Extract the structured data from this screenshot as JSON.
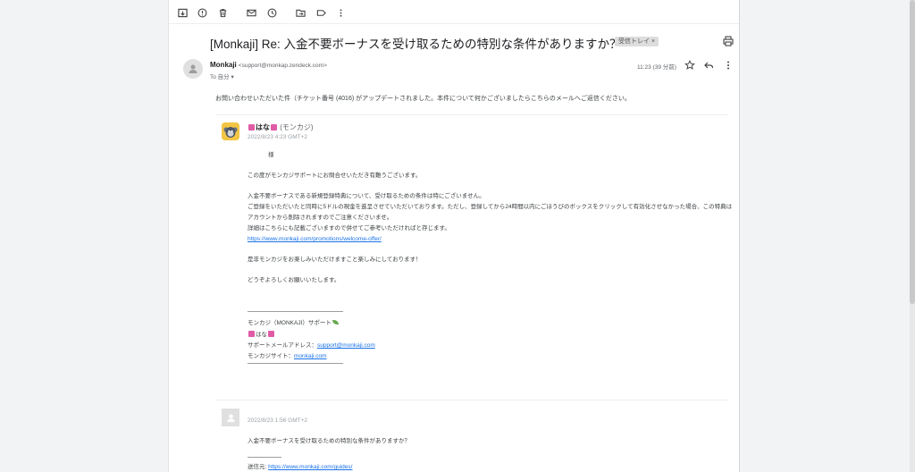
{
  "toolbar": {
    "icons": [
      "archive-icon",
      "report-spam-icon",
      "delete-icon",
      "mark-unread-icon",
      "snooze-icon",
      "move-to-icon",
      "label-icon",
      "more-icon"
    ]
  },
  "message": {
    "subject": "[Monkaji] Re: 入金不要ボーナスを受け取るための特別な条件がありますか？",
    "label": "受信トレイ ×",
    "sender_name": "Monkaji",
    "sender_email": "<support@monkap.zendeck.com>",
    "to": "To 自分 ▾",
    "time": "11:23 (39 分前)",
    "intro": "お問い合わせいただいた件（チケット番号 (4016) がアップデートされました。本件について何かございましたらこちらのメールへご返信ください。"
  },
  "reply": {
    "agent_name": "はな",
    "agent_sub": "(モンカジ)",
    "date": "2022/8/23 4:23 GMT+2",
    "salutation": "様",
    "p1": "この度がモンカジサポートにお問合せいただき有難うございます。",
    "p2_l1": "入金不要ボーナスである新規登録特典について、受け取るための条件は特にございません。",
    "p2_l2": "ご登録をいただいたと同時に5ドルの現金を進呈させていただいております。ただし、登録してから24時間以内にごほうびのボックスをクリックして有効化させなかった場合、この特典は",
    "p2_l3": "アカウントから削除されますのでご注意くださいませ。",
    "p2_l4": "詳細はこちらにも記載ございますので併せてご参考いただければと存じます。",
    "link": "https://www.monkaji.com/promotions/welcome-offer/",
    "p3": "是非モンカジをお楽しみいただけますこと楽しみにしております！",
    "p4": "どうぞよろしくお願いいたします。",
    "sig_team": "モンカジ（MONKAJI）サポート",
    "sig_name": "はな",
    "sig_mail_label": "サポートメールアドレス：",
    "sig_mail": "support@monkaji.com",
    "sig_site_label": "モンカジサイト：",
    "sig_site": "monkaji.com"
  },
  "original": {
    "date": "2022/8/23 1:56 GMT+2",
    "question": "入金不要ボーナスを受け取るための特別な条件がありますか？",
    "source_label": "送信元: ",
    "source_link": "https://www.monkaji.com/guides/"
  }
}
